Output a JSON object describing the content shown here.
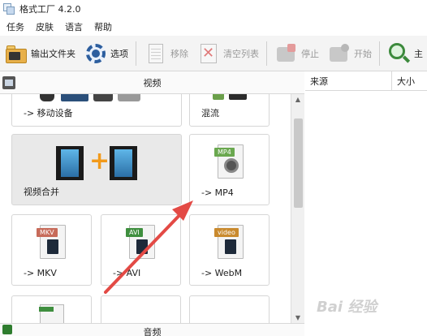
{
  "window": {
    "title": "格式工厂 4.2.0"
  },
  "menu": [
    "任务",
    "皮肤",
    "语言",
    "帮助"
  ],
  "toolbar": {
    "output_folder": "输出文件夹",
    "options": "选项",
    "remove": "移除",
    "clear_list": "清空列表",
    "stop": "停止",
    "start": "开始",
    "main": "主"
  },
  "categories": {
    "video": "视频",
    "audio": "音频"
  },
  "tiles": {
    "mobile": "-> 移动设备",
    "mix": "混流",
    "merge": "视频合并",
    "mp4": "-> MP4",
    "mkv": "-> MKV",
    "avi": "-> AVI",
    "webm": "-> WebM"
  },
  "badges": {
    "mp4": "MP4",
    "mkv": "MKV",
    "avi": "AVI",
    "webm": "video"
  },
  "colors": {
    "mp4": "#6aa84f",
    "mkv": "#c76b5a",
    "avi": "#3f8f3f",
    "webm": "#c98a2e",
    "annotation_arrow": "#e34a45"
  },
  "file_list": {
    "col_source": "来源",
    "col_size": "大小"
  },
  "watermark": "Bai 经验"
}
